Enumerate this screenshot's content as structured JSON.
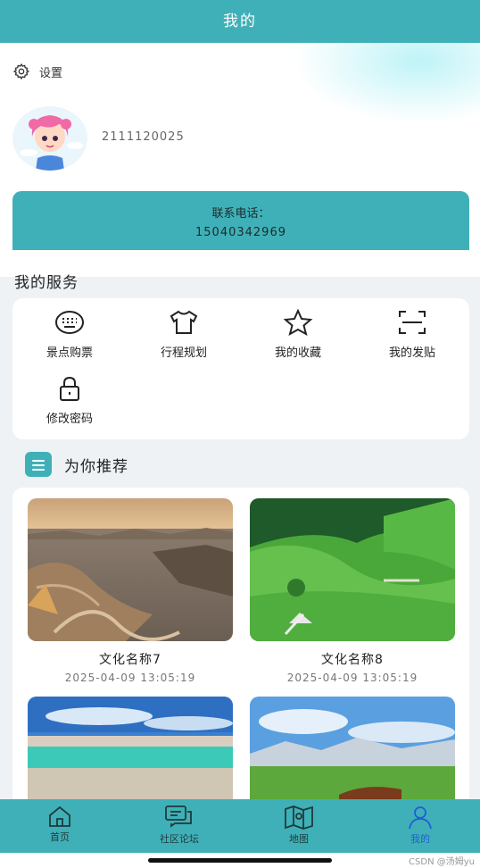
{
  "header": {
    "title": "我的"
  },
  "settings": {
    "label": "设置",
    "icon": "gear-icon"
  },
  "user": {
    "id": "2111120025"
  },
  "phone": {
    "label": "联系电话：",
    "number": "15040342969"
  },
  "services": {
    "title": "我的服务",
    "items": [
      {
        "label": "景点购票",
        "icon": "keyboard-icon"
      },
      {
        "label": "行程规划",
        "icon": "shirt-icon"
      },
      {
        "label": "我的收藏",
        "icon": "star-icon"
      },
      {
        "label": "我的发贴",
        "icon": "scan-icon"
      },
      {
        "label": "修改密码",
        "icon": "lock-icon"
      }
    ]
  },
  "recommend": {
    "title": "为你推荐",
    "cards": [
      {
        "title": "文化名称7",
        "date": "2025-04-09 13:05:19"
      },
      {
        "title": "文化名称8",
        "date": "2025-04-09 13:05:19"
      }
    ]
  },
  "tabbar": {
    "tabs": [
      {
        "label": "首页",
        "icon": "home-icon"
      },
      {
        "label": "社区论坛",
        "icon": "chat-icon"
      },
      {
        "label": "地图",
        "icon": "map-icon"
      },
      {
        "label": "我的",
        "icon": "person-icon",
        "active": true
      }
    ],
    "active_color": "#1f5fd6"
  },
  "watermark": "CSDN @汤姆yu",
  "colors": {
    "accent": "#3fb0b7"
  }
}
